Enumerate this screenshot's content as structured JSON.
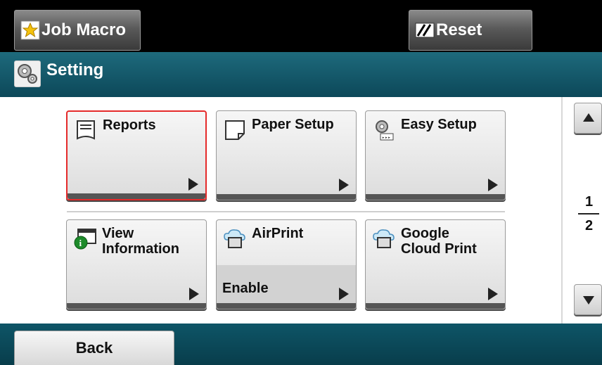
{
  "topbar": {
    "job_macro_label": "Job Macro",
    "reset_label": "Reset"
  },
  "header": {
    "title": "Setting"
  },
  "tiles": [
    {
      "label": "Reports",
      "icon": "reports-icon"
    },
    {
      "label": "Paper Setup",
      "icon": "paper-icon"
    },
    {
      "label": "Easy Setup",
      "icon": "gear-icon"
    },
    {
      "label": "View\nInformation",
      "icon": "info-icon"
    },
    {
      "label": "AirPrint",
      "value": "Enable",
      "icon": "cloud-printer-icon"
    },
    {
      "label": "Google\nCloud Print",
      "icon": "cloud-printer-icon"
    }
  ],
  "pager": {
    "page_1": "1",
    "page_2": "2"
  },
  "footer": {
    "back_label": "Back"
  },
  "colors": {
    "header_bg": "#0c4859",
    "selected_border": "#e52a2a"
  }
}
